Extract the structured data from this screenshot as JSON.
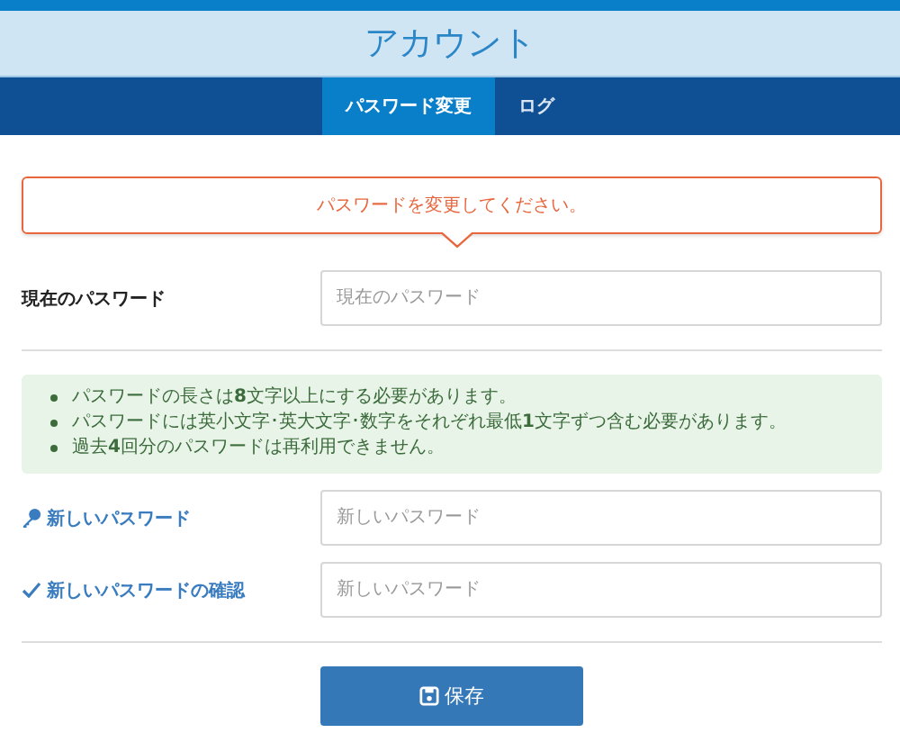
{
  "header": {
    "title": "アカウント"
  },
  "tabs": [
    {
      "label": "パスワード変更",
      "selected": true
    },
    {
      "label": "ログ",
      "selected": false
    }
  ],
  "alert": {
    "message": "パスワードを変更してください。"
  },
  "current_password": {
    "label": "現在のパスワード",
    "placeholder": "現在のパスワード"
  },
  "rules": [
    "パスワードの長さは**8**文字以上にする必要があります。",
    "パスワードには英小文字･英大文字･数字をそれぞれ最低**1**文字ずつ含む必要があります。",
    "過去**4**回分のパスワードは再利用できません。"
  ],
  "new_fields": [
    {
      "label": "新しいパスワード",
      "kind": "key",
      "placeholder": "新しいパスワード"
    },
    {
      "label": "新しいパスワードの確認",
      "kind": "check",
      "placeholder": "新しいパスワード"
    }
  ],
  "save_button": {
    "label": "保存"
  }
}
